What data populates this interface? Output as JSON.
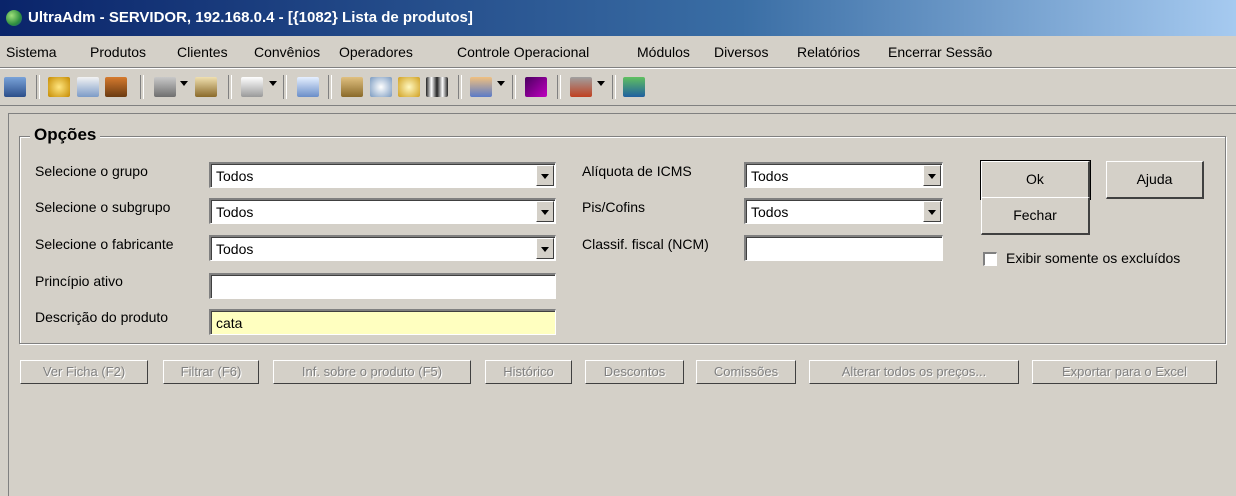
{
  "window": {
    "title": "UltraAdm - SERVIDOR, 192.168.0.4 - [{1082} Lista de produtos]"
  },
  "menu": [
    "Sistema",
    "Produtos",
    "Clientes",
    "Convênios",
    "Operadores",
    "Controle Operacional",
    "Módulos",
    "Diversos",
    "Relatórios",
    "Encerrar Sessão"
  ],
  "toolbar": {
    "icons": [
      "users-icon",
      "globe-icon",
      "calendar-icon",
      "tools-icon",
      "printer-icon",
      "edit-icon",
      "mouse-icon",
      "person-icon",
      "pencil-icon",
      "magnifier-icon",
      "clock-icon",
      "barcode-icon",
      "people-icon",
      "chart-icon",
      "chemistry-icon",
      "exit-icon"
    ]
  },
  "options": {
    "caption": "Opções",
    "grupo_label": "Selecione o grupo",
    "grupo_value": "Todos",
    "subgrupo_label": "Selecione o subgrupo",
    "subgrupo_value": "Todos",
    "fabricante_label": "Selecione o fabricante",
    "fabricante_value": "Todos",
    "principio_label": "Princípio ativo",
    "principio_value": "",
    "descricao_label": "Descrição do produto",
    "descricao_value": "cata",
    "icms_label": "Alíquota de ICMS",
    "icms_value": "Todos",
    "piscofins_label": "Pis/Cofins",
    "piscofins_value": "Todos",
    "ncm_label": "Classif. fiscal (NCM)",
    "ncm_value": "",
    "ok_label": "Ok",
    "ajuda_label": "Ajuda",
    "fechar_label": "Fechar",
    "excluidos_label": "Exibir somente os excluídos"
  },
  "actions": [
    "Ver Ficha (F2)",
    "Filtrar (F6)",
    "Inf. sobre o produto (F5)",
    "Histórico",
    "Descontos",
    "Comissões",
    "Alterar todos os preços...",
    "Exportar para o Excel"
  ],
  "colors": {
    "title_start": "#0a246a",
    "title_end": "#a6caf0",
    "face": "#d4d0c8",
    "highlight_field": "#ffffc0"
  }
}
